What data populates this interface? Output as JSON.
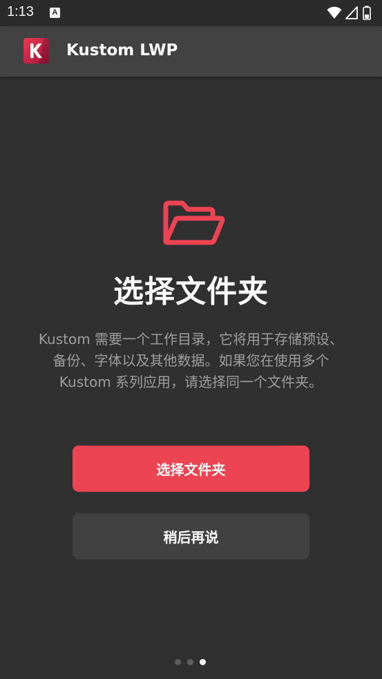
{
  "status_bar": {
    "time": "1:13",
    "notification_icon": "A",
    "icons": [
      "wifi-icon",
      "cellular-signal-icon",
      "battery-icon"
    ]
  },
  "app_bar": {
    "logo_letter": "K",
    "title": "Kustom LWP"
  },
  "onboarding": {
    "icon": "folder-open-icon",
    "title": "选择文件夹",
    "description": "Kustom 需要一个工作目录，它将用于存储预设、备份、字体以及其他数据。如果您在使用多个 Kustom 系列应用，请选择同一个文件夹。",
    "primary_button": "选择文件夹",
    "secondary_button": "稍后再说",
    "pagination": {
      "total": 3,
      "current": 3
    }
  },
  "colors": {
    "background": "#303030",
    "app_bar": "#424242",
    "accent": "#ec4452",
    "text_secondary": "#9e9e9e"
  }
}
